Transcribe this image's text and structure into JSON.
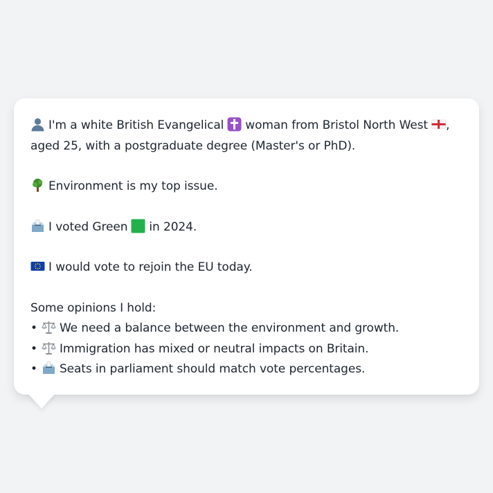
{
  "profile": {
    "intro_line1_pre": "I'm a white British Evangelical",
    "intro_line1_mid": "woman from Bristol North West",
    "intro_line1_post": ",",
    "intro_line2": "aged 25, with a postgraduate degree (Master's or PhD).",
    "top_issue": "Environment is my top issue.",
    "vote_pre": "I voted Green",
    "vote_post": "in 2024.",
    "eu": "I would vote to rejoin the EU today.",
    "opinions_heading": "Some opinions I hold:",
    "opinions": [
      {
        "bullet": "•",
        "icon": "balance-scale-icon",
        "text": "We need a balance between the environment and growth."
      },
      {
        "bullet": "•",
        "icon": "balance-scale-icon",
        "text": "Immigration has mixed or neutral impacts on Britain."
      },
      {
        "bullet": "•",
        "icon": "ballot-box-icon",
        "text": "Seats in parliament should match vote percentages."
      }
    ]
  },
  "colors": {
    "background": "#f2f3f5",
    "bubble": "#ffffff",
    "text": "#1e2530",
    "cross_badge": "#9b4fc9",
    "green_square": "#22b14c",
    "eu_blue": "#0f3fa8",
    "england_red": "#d42a35"
  }
}
